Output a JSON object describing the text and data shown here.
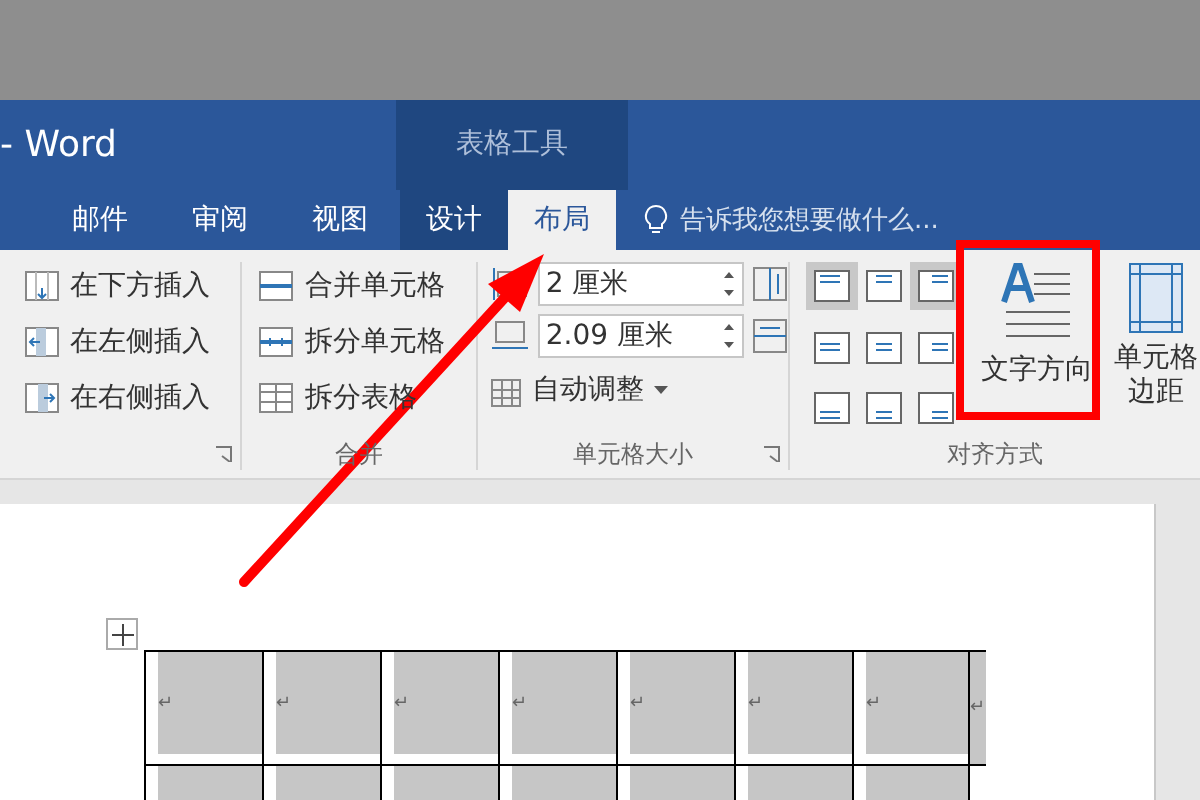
{
  "window": {
    "title": "- Word",
    "context_group": "表格工具"
  },
  "tabs": [
    {
      "label": "邮件",
      "selected": false
    },
    {
      "label": "审阅",
      "selected": false
    },
    {
      "label": "视图",
      "selected": false
    },
    {
      "label": "设计",
      "selected": false,
      "contextual": true
    },
    {
      "label": "布局",
      "selected": true,
      "contextual": true
    }
  ],
  "tell_me": {
    "placeholder": "告诉我您想要做什么..."
  },
  "ribbon": {
    "rows_columns": {
      "items": [
        {
          "label": "在下方插入",
          "kind": "below"
        },
        {
          "label": "在左侧插入",
          "kind": "left"
        },
        {
          "label": "在右侧插入",
          "kind": "right"
        }
      ]
    },
    "merge": {
      "label": "合并",
      "items": [
        {
          "label": "合并单元格",
          "kind": "merge"
        },
        {
          "label": "拆分单元格",
          "kind": "split"
        },
        {
          "label": "拆分表格",
          "kind": "table"
        }
      ]
    },
    "cell_size": {
      "label": "单元格大小",
      "height": "2 厘米",
      "width": "2.09 厘米",
      "autofit": "自动调整"
    },
    "alignment": {
      "label": "对齐方式",
      "buttons": [
        {
          "selected": true
        },
        {
          "selected": false
        },
        {
          "selected": true
        },
        {
          "selected": false
        },
        {
          "selected": false
        },
        {
          "selected": false
        },
        {
          "selected": false
        },
        {
          "selected": false
        },
        {
          "selected": false
        }
      ],
      "text_direction": "文字方向",
      "cell_margins": [
        "单元格",
        "边距"
      ]
    }
  },
  "table": {
    "rows": [
      {
        "cells": [
          "↵",
          "↵",
          "↵",
          "↵",
          "↵",
          "↵",
          "↵"
        ],
        "end_mark": "↵"
      },
      {
        "cells": [
          "",
          "",
          "",
          "",
          "",
          "",
          ""
        ]
      }
    ]
  }
}
